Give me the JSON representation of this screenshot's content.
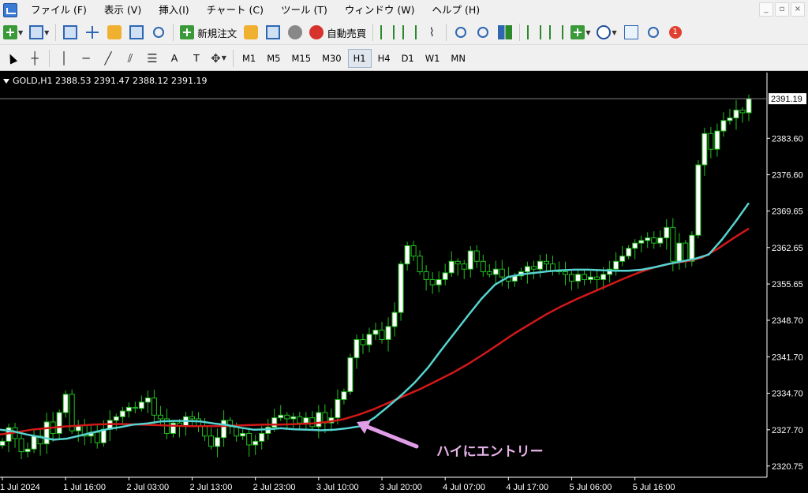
{
  "menu": {
    "items": [
      "ファイル (F)",
      "表示 (V)",
      "挿入(I)",
      "チャート (C)",
      "ツール (T)",
      "ウィンドウ (W)",
      "ヘルプ (H)"
    ],
    "window_controls": [
      "_",
      "▫",
      "×"
    ]
  },
  "toolbar": {
    "new_order": "新規注文",
    "auto_trading": "自動売買",
    "notification_count": "1"
  },
  "drawing_toolbar": {
    "text_tool": "A",
    "label_tool": "T"
  },
  "timeframes": {
    "items": [
      "M1",
      "M5",
      "M15",
      "M30",
      "H1",
      "H4",
      "D1",
      "W1",
      "MN"
    ],
    "active": "H1"
  },
  "chart": {
    "title": "GOLD,H1  2388.53 2391.47 2388.12 2391.19",
    "annotation": "ハイにエントリー",
    "colors": {
      "background": "#000000",
      "bull_candle": "#ffffff",
      "bear_candle": "#000000",
      "candle_outline": "#22c11f",
      "fast_ma": "#56d3d0",
      "slow_ma": "#d21818",
      "annotation_text": "#e8b4ea",
      "annotation_arrow": "#e19de8",
      "current_price_line": "#808080"
    }
  },
  "chart_data": {
    "type": "candlestick",
    "symbol": "GOLD",
    "timeframe": "H1",
    "ohlc_last": {
      "open": 2388.53,
      "high": 2391.47,
      "low": 2388.12,
      "close": 2391.19
    },
    "current_price_label": "2391.19",
    "y_ticks": [
      2383.6,
      2376.6,
      2369.65,
      2362.65,
      2355.65,
      2348.7,
      2341.7,
      2334.7,
      2327.7,
      2320.75
    ],
    "y_tick_labels": [
      "2383.60",
      "2376.60",
      "2369.65",
      "2362.65",
      "2355.65",
      "2348.70",
      "2341.70",
      "2334.70",
      "2327.70",
      "2320.75"
    ],
    "x_tick_labels": [
      "1 Jul 2024",
      "1 Jul 16:00",
      "2 Jul 03:00",
      "2 Jul 13:00",
      "2 Jul 23:00",
      "3 Jul 10:00",
      "3 Jul 20:00",
      "4 Jul 07:00",
      "4 Jul 17:00",
      "5 Jul 06:00",
      "5 Jul 16:00"
    ],
    "ylim": [
      2318.6,
      2396.2
    ],
    "closes": [
      2325.5,
      2328.1,
      2326.0,
      2323.5,
      2324.0,
      2326.5,
      2325.0,
      2329.2,
      2327.0,
      2331.0,
      2334.5,
      2327.5,
      2328.5,
      2326.5,
      2327.2,
      2325.2,
      2327.8,
      2329.5,
      2330.2,
      2331.3,
      2332.0,
      2331.8,
      2333.0,
      2333.8,
      2330.5,
      2329.8,
      2327.0,
      2329.0,
      2328.5,
      2330.2,
      2329.8,
      2328.5,
      2326.5,
      2324.5,
      2326.2,
      2329.5,
      2328.3,
      2326.5,
      2327.0,
      2324.8,
      2325.5,
      2327.0,
      2328.2,
      2330.0,
      2330.5,
      2329.8,
      2330.2,
      2329.0,
      2330.0,
      2328.3,
      2331.0,
      2329.0,
      2330.0,
      2333.5,
      2335.0,
      2341.5,
      2345.0,
      2344.0,
      2346.0,
      2346.8,
      2345.0,
      2347.5,
      2350.2,
      2359.5,
      2363.0,
      2361.0,
      2358.0,
      2356.5,
      2355.5,
      2356.5,
      2357.8,
      2360.0,
      2359.5,
      2358.5,
      2362.0,
      2360.0,
      2358.0,
      2357.5,
      2358.5,
      2357.0,
      2356.2,
      2357.2,
      2358.0,
      2359.0,
      2358.5,
      2360.0,
      2359.5,
      2358.2,
      2358.0,
      2357.5,
      2356.2,
      2357.5,
      2356.5,
      2357.0,
      2356.5,
      2357.5,
      2358.5,
      2360.0,
      2361.0,
      2362.5,
      2363.5,
      2364.0,
      2364.5,
      2363.5,
      2364.5,
      2366.5,
      2360.0,
      2363.5,
      2360.0,
      2365.0,
      2378.5,
      2384.5,
      2381.5,
      2385.0,
      2387.0,
      2387.5,
      2389.0,
      2388.5,
      2391.19
    ],
    "ma_fast": [
      2327.7,
      2327.4,
      2326.8,
      2326.3,
      2325.8,
      2326.0,
      2326.6,
      2327.2,
      2327.8,
      2328.2,
      2328.7,
      2328.9,
      2329.3,
      2329.4,
      2329.4,
      2329.3,
      2328.9,
      2328.6,
      2328.1,
      2327.7,
      2327.8,
      2328.0,
      2327.8,
      2327.7,
      2327.6,
      2327.7,
      2328.0,
      2328.4,
      2330.0,
      2332.1,
      2334.3,
      2336.7,
      2339.6,
      2343.0,
      2346.3,
      2349.6,
      2352.8,
      2355.5,
      2357.0,
      2357.5,
      2357.8,
      2358.1,
      2358.3,
      2358.4,
      2358.4,
      2358.3,
      2358.2,
      2358.2,
      2358.4,
      2358.9,
      2359.5,
      2360.0,
      2360.5,
      2361.3,
      2364.2,
      2367.6,
      2371.2
    ],
    "ma_slow": [
      2326.8,
      2327.2,
      2327.7,
      2328.0,
      2328.3,
      2328.5,
      2328.7,
      2328.8,
      2328.8,
      2328.7,
      2328.6,
      2328.5,
      2328.4,
      2328.4,
      2328.4,
      2328.5,
      2328.6,
      2328.7,
      2328.7,
      2328.8,
      2328.9,
      2329.2,
      2329.7,
      2330.6,
      2331.7,
      2333.0,
      2334.3,
      2335.6,
      2337.1,
      2338.6,
      2340.3,
      2342.2,
      2344.2,
      2346.2,
      2348.0,
      2349.8,
      2351.4,
      2352.8,
      2354.1,
      2355.4,
      2356.7,
      2357.9,
      2358.9,
      2359.6,
      2360.0,
      2360.7,
      2362.4,
      2364.4,
      2366.3
    ]
  }
}
